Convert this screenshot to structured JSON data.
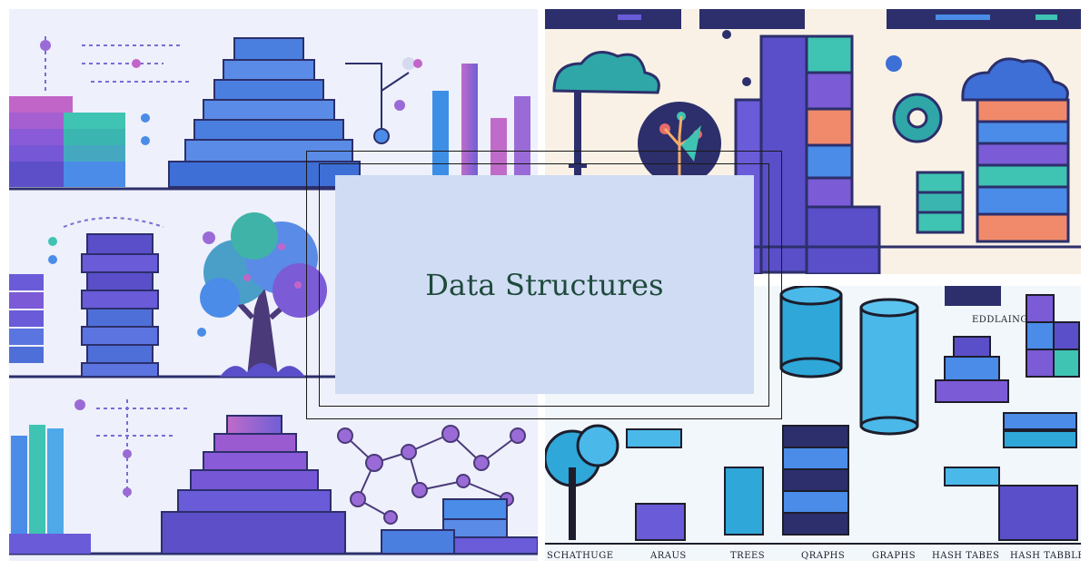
{
  "banner": {
    "title": "Data Structures"
  },
  "captions": [
    "SCHATHUGE",
    "ARAUS",
    "TREES",
    "QRAPHS",
    "GRAPHS",
    "HASH TABES",
    "HASH TABBLES"
  ],
  "sticker_label": "EDDLAING",
  "palette": {
    "purple": "#7b5bd6",
    "blue": "#4a8ce8",
    "teal": "#3fc3b2",
    "pink": "#b06ad4",
    "navy": "#2c2f6b",
    "title_bg": "#cfdcf3",
    "title_color": "#1e4a3c"
  }
}
